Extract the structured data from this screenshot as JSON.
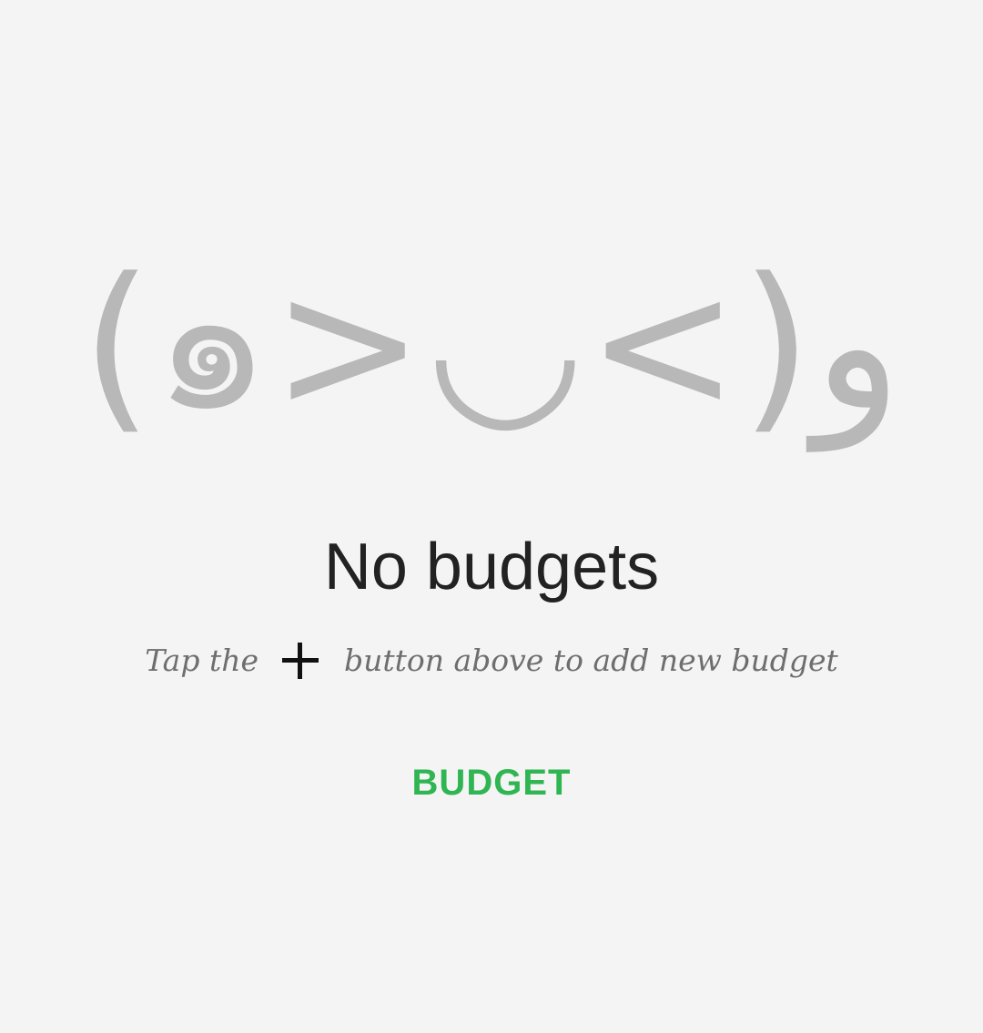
{
  "empty_state": {
    "emoticon": "(๑>◡<)و",
    "title": "No budgets",
    "hint_before": "Tap the",
    "hint_icon": "plus-icon",
    "hint_after": "button above to add new budget",
    "action_label": "BUDGET"
  },
  "colors": {
    "background": "#f4f4f4",
    "emoticon": "#b8b8b8",
    "title": "#222222",
    "hint": "#6e6e6e",
    "accent": "#2fb552"
  }
}
